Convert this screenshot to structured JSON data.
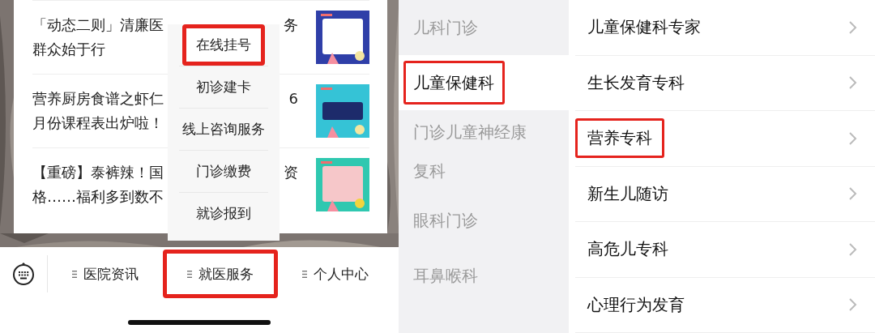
{
  "news_panel": {
    "articles": [
      {
        "lines": [
          "「动态二则」清廉医",
          "群众始于行"
        ],
        "tail": "务"
      },
      {
        "lines": [
          "营养厨房食谱之虾仁",
          "月份课程表出炉啦！"
        ],
        "tail": "6"
      },
      {
        "lines": [
          "【重磅】泰裤辣！国",
          "格……福利多到数不"
        ],
        "tail": "资"
      }
    ],
    "popup_menu": {
      "items": [
        {
          "label": "在线挂号",
          "highlighted": true
        },
        {
          "label": "初诊建卡",
          "highlighted": false
        },
        {
          "label": "线上咨询服务",
          "highlighted": false
        },
        {
          "label": "门诊缴费",
          "highlighted": false
        },
        {
          "label": "就诊报到",
          "highlighted": false
        }
      ]
    },
    "bottom_nav": {
      "tabs": [
        {
          "label": "医院资讯",
          "highlighted": false
        },
        {
          "label": "就医服务",
          "highlighted": true
        },
        {
          "label": "个人中心",
          "highlighted": false
        }
      ]
    }
  },
  "departments": {
    "categories": [
      {
        "label": "儿科门诊",
        "selected": false,
        "highlighted": false
      },
      {
        "label": "儿童保健科",
        "selected": true,
        "highlighted": true
      },
      {
        "label": "门诊儿童神经康复科",
        "selected": false,
        "highlighted": false
      },
      {
        "label": "眼科门诊",
        "selected": false,
        "highlighted": false
      },
      {
        "label": "耳鼻喉科",
        "selected": false,
        "highlighted": false
      }
    ],
    "subdepartments": [
      {
        "label": "儿童保健科专家",
        "highlighted": false
      },
      {
        "label": "生长发育专科",
        "highlighted": false
      },
      {
        "label": "营养专科",
        "highlighted": true
      },
      {
        "label": "新生儿随访",
        "highlighted": false
      },
      {
        "label": "高危儿专科",
        "highlighted": false
      },
      {
        "label": "心理行为发育",
        "highlighted": false
      }
    ]
  }
}
